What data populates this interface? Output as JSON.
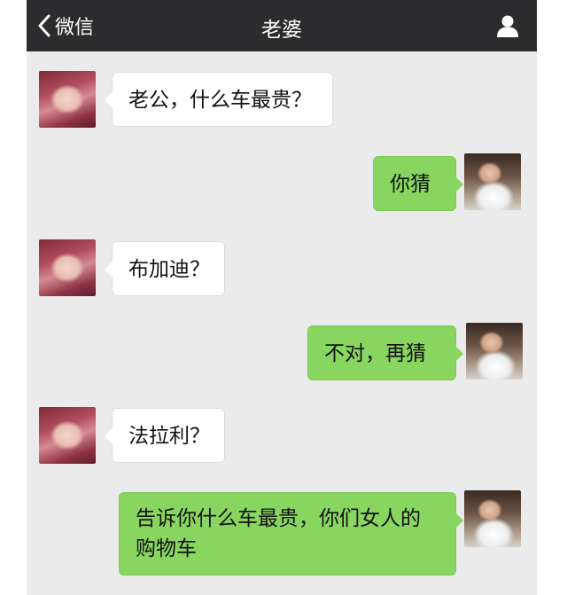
{
  "header": {
    "back_label": "微信",
    "title": "老婆"
  },
  "messages": [
    {
      "sender": "wife",
      "side": "left",
      "text": "老公，什么车最贵？"
    },
    {
      "sender": "husband",
      "side": "right",
      "text": "你猜"
    },
    {
      "sender": "wife",
      "side": "left",
      "text": "布加迪？"
    },
    {
      "sender": "husband",
      "side": "right",
      "text": "不对，再猜"
    },
    {
      "sender": "wife",
      "side": "left",
      "text": "法拉利？"
    },
    {
      "sender": "husband",
      "side": "right",
      "text": "告诉你什么车最贵，你们女人的购物车"
    }
  ],
  "colors": {
    "topbar": "#2c2c2e",
    "chat_background": "#ebebeb",
    "incoming_bubble": "#ffffff",
    "outgoing_bubble": "#88d660"
  }
}
